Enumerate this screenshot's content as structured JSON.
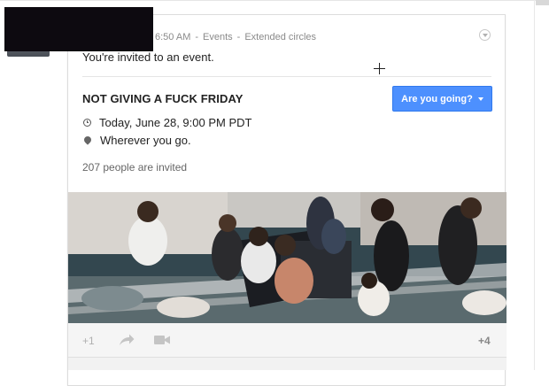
{
  "post": {
    "time": "6:50 AM",
    "category": "Events",
    "audience": "Extended circles",
    "separator": "-",
    "text": "You're invited to an event."
  },
  "event": {
    "title": "NOT GIVING A FUCK FRIDAY",
    "rsvp_label": "Are you going?",
    "date": "Today, June 28, 9:00 PM PDT",
    "location": "Wherever you go.",
    "invited": "207 people are invited"
  },
  "actions": {
    "plus_one": "+1",
    "plus_count": "+4"
  },
  "icons": {
    "more": "chevron-down-circle-icon",
    "time": "clock-icon",
    "location": "map-pin-icon",
    "share": "share-arrow-icon",
    "hangout": "video-camera-icon",
    "rsvp_caret": "caret-down-icon"
  },
  "colors": {
    "button": "#4d90fe",
    "button_border": "#3079ed",
    "meta_text": "#8a8a8a",
    "action_bar": "#f5f5f5"
  }
}
